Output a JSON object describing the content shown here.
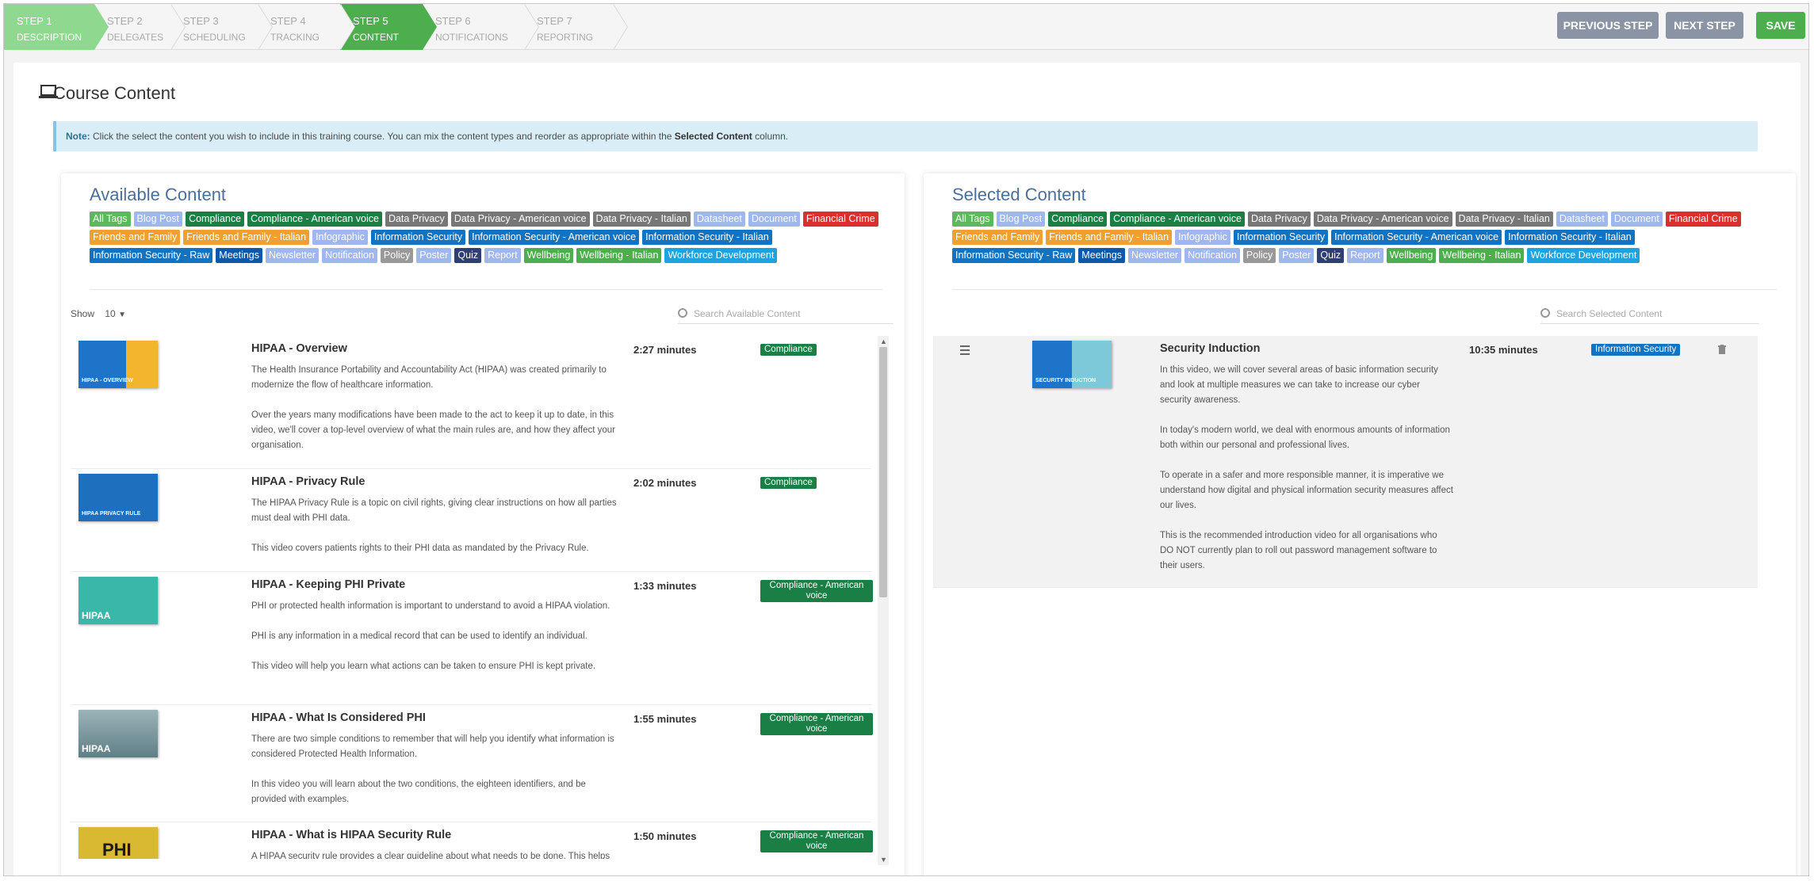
{
  "wizard": {
    "steps": [
      {
        "num": "STEP 1",
        "label": "DESCRIPTION"
      },
      {
        "num": "STEP 2",
        "label": "DELEGATES"
      },
      {
        "num": "STEP 3",
        "label": "SCHEDULING"
      },
      {
        "num": "STEP 4",
        "label": "TRACKING"
      },
      {
        "num": "STEP 5",
        "label": "CONTENT"
      },
      {
        "num": "STEP 6",
        "label": "NOTIFICATIONS"
      },
      {
        "num": "STEP 7",
        "label": "REPORTING"
      }
    ],
    "previous_label": "PREVIOUS STEP",
    "next_label": "NEXT STEP",
    "save_label": "SAVE"
  },
  "page": {
    "title": "Course Content",
    "note_prefix": "Note:",
    "note_text": " Click the select the content you wish to include in this training course. You can mix the content types and reorder as appropriate within the ",
    "note_bold": "Selected Content",
    "note_suffix": " column."
  },
  "tags": [
    {
      "label": "All Tags",
      "color": "#5cb85c"
    },
    {
      "label": "Blog Post",
      "color": "#9fb7ee"
    },
    {
      "label": "Compliance",
      "color": "#1a7f45"
    },
    {
      "label": "Compliance - American voice",
      "color": "#1a7f45"
    },
    {
      "label": "Data Privacy",
      "color": "#777777"
    },
    {
      "label": "Data Privacy - American voice",
      "color": "#777777"
    },
    {
      "label": "Data Privacy - Italian",
      "color": "#777777"
    },
    {
      "label": "Datasheet",
      "color": "#9fb7ee"
    },
    {
      "label": "Document",
      "color": "#9fb7ee"
    },
    {
      "label": "Financial Crime",
      "color": "#d9302c"
    },
    {
      "label": "Friends and Family",
      "color": "#f0a030"
    },
    {
      "label": "Friends and Family - Italian",
      "color": "#f0a030"
    },
    {
      "label": "Infographic",
      "color": "#9fb7ee"
    },
    {
      "label": "Information Security",
      "color": "#1173c2"
    },
    {
      "label": "Information Security - American voice",
      "color": "#1173c2"
    },
    {
      "label": "Information Security - Italian",
      "color": "#1173c2"
    },
    {
      "label": "Information Security - Raw",
      "color": "#1173c2"
    },
    {
      "label": "Meetings",
      "color": "#0d58a8"
    },
    {
      "label": "Newsletter",
      "color": "#9fb7ee"
    },
    {
      "label": "Notification",
      "color": "#9fb7ee"
    },
    {
      "label": "Policy",
      "color": "#999999"
    },
    {
      "label": "Poster",
      "color": "#9fb7ee"
    },
    {
      "label": "Quiz",
      "color": "#2f3f73"
    },
    {
      "label": "Report",
      "color": "#9fb7ee"
    },
    {
      "label": "Wellbeing",
      "color": "#4cae4c"
    },
    {
      "label": "Wellbeing - Italian",
      "color": "#4cae4c"
    },
    {
      "label": "Workforce Development",
      "color": "#1fa3e0"
    }
  ],
  "available": {
    "title": "Available Content",
    "show_label": "Show",
    "show_value": "10",
    "search_placeholder": "Search Available Content",
    "items": [
      {
        "title": "HIPAA - Overview",
        "duration": "2:27 minutes",
        "tag": "Compliance",
        "thumb_text": "HIPAA - OVERVIEW",
        "paragraphs": [
          "The Health Insurance Portability and Accountability Act (HIPAA) was created primarily to modernize the flow of healthcare information.",
          "Over the years many modifications have been made to the act to keep it up to date, in this video, we'll cover a top-level overview of what the main rules are, and how they affect your organisation."
        ]
      },
      {
        "title": "HIPAA - Privacy Rule",
        "duration": "2:02 minutes",
        "tag": "Compliance",
        "thumb_text": "HIPAA PRIVACY RULE",
        "paragraphs": [
          "The HIPAA Privacy Rule is a topic on civil rights, giving clear instructions on how all parties must deal with PHI data.",
          "This video covers patients rights to their PHI data as mandated by the Privacy Rule."
        ]
      },
      {
        "title": "HIPAA - Keeping PHI Private",
        "duration": "1:33 minutes",
        "tag": "Compliance - American voice",
        "thumb_text": "HIPAA",
        "paragraphs": [
          "PHI or protected health information is important to understand to avoid a HIPAA violation.",
          "PHI is any information in a medical record that can be used to identify an individual.",
          "This video will help you learn what actions can be taken to ensure PHI is kept private."
        ]
      },
      {
        "title": "HIPAA - What Is Considered PHI",
        "duration": "1:55 minutes",
        "tag": "Compliance - American voice",
        "thumb_text": "HIPAA",
        "paragraphs": [
          "There are two simple conditions to remember that will help you identify what information is considered Protected Health Information.",
          "In this video you will learn about the two conditions, the eighteen identifiers, and be provided with examples."
        ]
      },
      {
        "title": "HIPAA - What is HIPAA Security Rule",
        "duration": "1:50 minutes",
        "tag": "Compliance - American voice",
        "thumb_text": "PHI",
        "paragraphs": [
          "A HIPAA security rule provides a clear guideline about what needs to be done. This helps"
        ]
      }
    ]
  },
  "selected": {
    "title": "Selected Content",
    "search_placeholder": "Search Selected Content",
    "items": [
      {
        "title": "Security Induction",
        "duration": "10:35 minutes",
        "tag": "Information Security",
        "thumb_text": "SECURITY INDUCTION",
        "paragraphs": [
          "In this video, we will cover several areas of basic information security and look at multiple measures we can take to increase our cyber security awareness.",
          "In today's modern world, we deal with enormous amounts of information both within our personal and professional lives.",
          "To operate in a safer and more responsible manner, it is imperative we understand how digital and physical information security measures affect our lives.",
          "This is the recommended introduction video for all organisations who DO NOT currently plan to roll out password management software to their users."
        ]
      }
    ]
  },
  "colors": {
    "compliance": "#1a7f45",
    "info_security": "#1173c2",
    "title_blue": "#4b6f99"
  }
}
